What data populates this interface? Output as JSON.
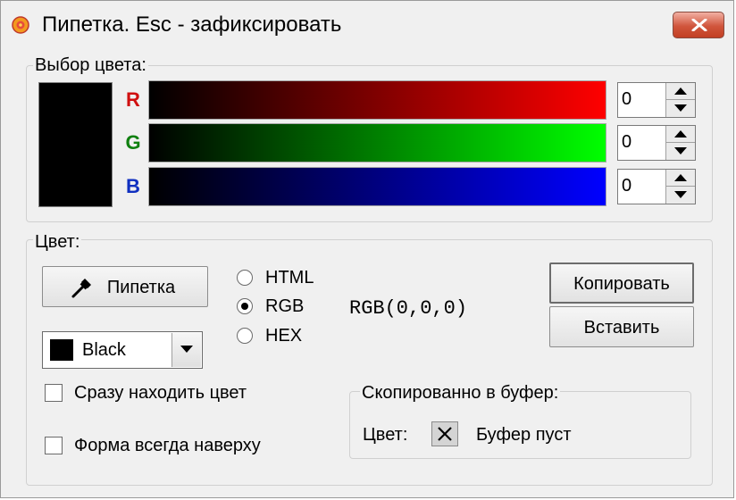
{
  "window": {
    "title": "Пипетка. Esc - зафиксировать"
  },
  "color_select": {
    "label": "Выбор цвета:",
    "channels": [
      {
        "letter": "R",
        "value": "0",
        "letter_color": "#d01010",
        "gradient_end": "#ff0000"
      },
      {
        "letter": "G",
        "value": "0",
        "letter_color": "#108010",
        "gradient_end": "#00ff00"
      },
      {
        "letter": "B",
        "value": "0",
        "letter_color": "#1030c0",
        "gradient_end": "#0000ff"
      }
    ],
    "current_color": "#000000"
  },
  "color_group": {
    "label": "Цвет:",
    "pipette_label": "Пипетка",
    "formats": [
      {
        "label": "HTML",
        "selected": false
      },
      {
        "label": "RGB",
        "selected": true
      },
      {
        "label": "HEX",
        "selected": false
      }
    ],
    "color_value": "RGB(0,0,0)",
    "copy_label": "Копировать",
    "paste_label": "Вставить",
    "named_color": "Black",
    "find_now_label": "Сразу находить цвет",
    "always_on_top_label": "Форма всегда наверху"
  },
  "clipboard": {
    "label": "Скопированно в буфер:",
    "color_label": "Цвет:",
    "status": "Буфер пуст"
  }
}
